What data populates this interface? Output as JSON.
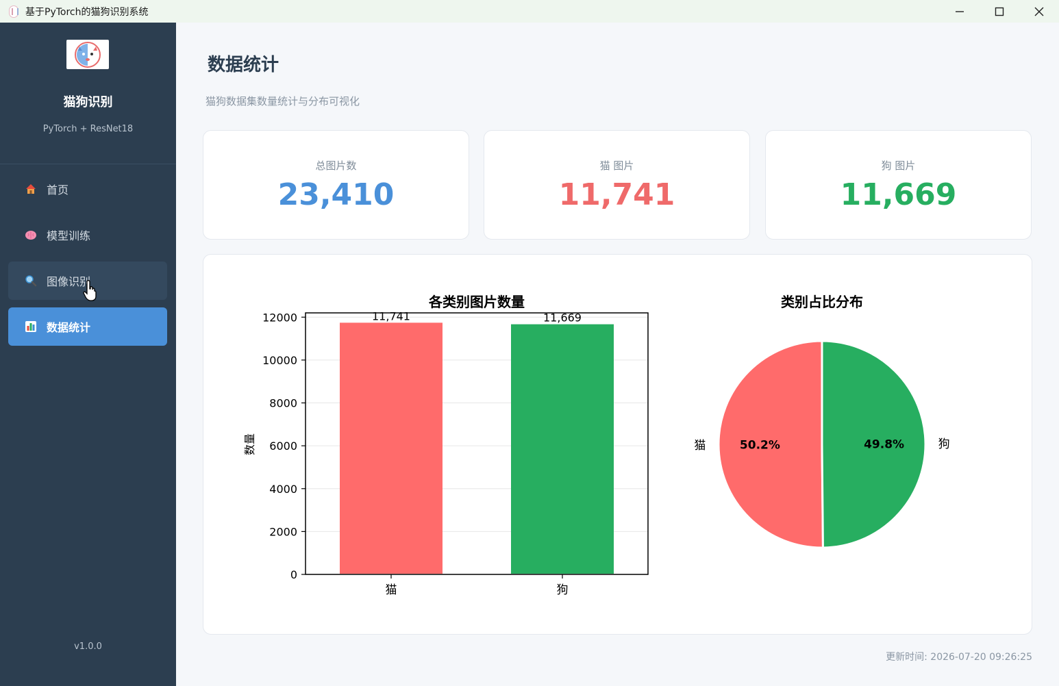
{
  "window": {
    "title": "基于PyTorch的猫狗识别系统",
    "minimize_icon": "minimize-icon",
    "maximize_icon": "maximize-icon",
    "close_icon": "close-icon"
  },
  "sidebar": {
    "brand_name": "猫狗识别",
    "brand_sub": "PyTorch + ResNet18",
    "items": [
      {
        "label": "首页",
        "icon": "home-icon"
      },
      {
        "label": "模型训练",
        "icon": "brain-icon"
      },
      {
        "label": "图像识别",
        "icon": "magnifier-icon"
      },
      {
        "label": "数据统计",
        "icon": "bar-chart-icon"
      }
    ],
    "active_index": 3,
    "hover_index": 2,
    "version": "v1.0.0"
  },
  "main": {
    "title": "数据统计",
    "subtitle": "猫狗数据集数量统计与分布可视化",
    "stats": [
      {
        "label": "总图片数",
        "value": "23,410",
        "color": "#4a90d9"
      },
      {
        "label": "猫 图片",
        "value": "11,741",
        "color": "#ef6a6a"
      },
      {
        "label": "狗 图片",
        "value": "11,669",
        "color": "#27ae60"
      }
    ],
    "update_time": "更新时间: 2026-07-20 09:26:25"
  },
  "chart_data": [
    {
      "type": "bar",
      "title": "各类别图片数量",
      "categories": [
        "猫",
        "狗"
      ],
      "values": [
        11741,
        11669
      ],
      "value_labels": [
        "11,741",
        "11,669"
      ],
      "colors": [
        "#ff6b6b",
        "#27ae60"
      ],
      "xlabel": "",
      "ylabel": "数量",
      "ylim": [
        0,
        12200
      ],
      "yticks": [
        0,
        2000,
        4000,
        6000,
        8000,
        10000,
        12000
      ],
      "grid": true
    },
    {
      "type": "pie",
      "title": "类别占比分布",
      "labels": [
        "猫",
        "狗"
      ],
      "values": [
        11741,
        11669
      ],
      "percent_labels": [
        "50.2%",
        "49.8%"
      ],
      "colors": [
        "#ff6b6b",
        "#27ae60"
      ]
    }
  ]
}
